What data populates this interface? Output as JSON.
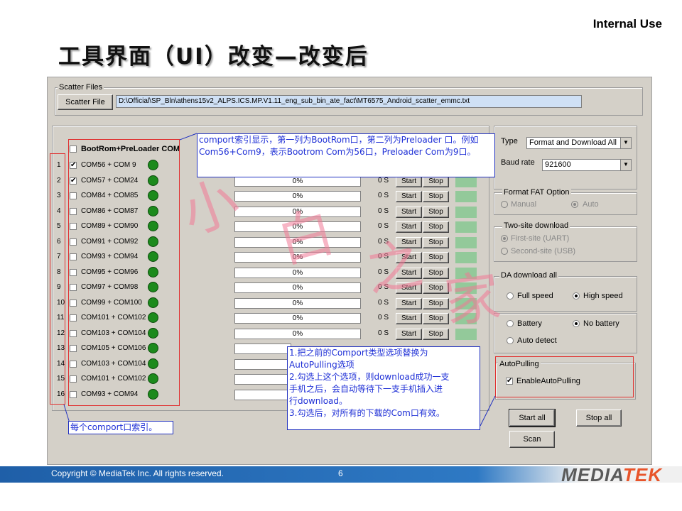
{
  "slide": {
    "internal_use": "Internal Use",
    "title": "工具界面（UI）改变—改变后",
    "copyright": "Copyright © MediaTek Inc. All rights reserved.",
    "page_number": "6",
    "brand_left": "MEDIA",
    "brand_right": "TEK",
    "watermark_chars": [
      "小",
      "白",
      "之",
      "家"
    ]
  },
  "scatter": {
    "group_title": "Scatter Files",
    "button_label": "Scatter File",
    "path": "D:\\Official\\SP_Bln\\athens15v2_ALPS.ICS.MP.V1.11_eng_sub_bin_ate_fact\\MT6575_Android_scatter_emmc.txt"
  },
  "ports": {
    "header_label": "BootRom+PreLoader COM",
    "header_checked": false,
    "start_label": "Start",
    "stop_label": "Stop",
    "rows": [
      {
        "num": "1",
        "label": "COM56 + COM 9",
        "checked": true,
        "progress": null,
        "time": null
      },
      {
        "num": "2",
        "label": "COM57 + COM24",
        "checked": true,
        "progress": "0%",
        "time": "0 S"
      },
      {
        "num": "3",
        "label": "COM84 + COM85",
        "checked": false,
        "progress": "0%",
        "time": "0 S"
      },
      {
        "num": "4",
        "label": "COM86 + COM87",
        "checked": false,
        "progress": "0%",
        "time": "0 S"
      },
      {
        "num": "5",
        "label": "COM89 + COM90",
        "checked": false,
        "progress": "0%",
        "time": "0 S"
      },
      {
        "num": "6",
        "label": "COM91 + COM92",
        "checked": false,
        "progress": "0%",
        "time": "0 S"
      },
      {
        "num": "7",
        "label": "COM93 + COM94",
        "checked": false,
        "progress": "0%",
        "time": "0 S"
      },
      {
        "num": "8",
        "label": "COM95 + COM96",
        "checked": false,
        "progress": "0%",
        "time": "0 S"
      },
      {
        "num": "9",
        "label": "COM97 + COM98",
        "checked": false,
        "progress": "0%",
        "time": "0 S"
      },
      {
        "num": "10",
        "label": "COM99 + COM100",
        "checked": false,
        "progress": "0%",
        "time": "0 S"
      },
      {
        "num": "11",
        "label": "COM101 + COM102",
        "checked": false,
        "progress": "0%",
        "time": "0 S"
      },
      {
        "num": "12",
        "label": "COM103 + COM104",
        "checked": false,
        "progress": "0%",
        "time": "0 S"
      },
      {
        "num": "13",
        "label": "COM105 + COM106",
        "checked": false,
        "progress": null,
        "time": null
      },
      {
        "num": "14",
        "label": "COM103 + COM104",
        "checked": false,
        "progress": null,
        "time": null
      },
      {
        "num": "15",
        "label": "COM101 + COM102",
        "checked": false,
        "progress": null,
        "time": null
      },
      {
        "num": "16",
        "label": "COM93 + COM94",
        "checked": false,
        "progress": null,
        "time": null
      }
    ]
  },
  "settings": {
    "type_label": "Type",
    "type_value": "Format and Download All",
    "baud_label": "Baud rate",
    "baud_value": "921600",
    "format_fat": {
      "title": "Format FAT Option",
      "manual": "Manual",
      "auto": "Auto"
    },
    "two_site": {
      "title": "Two-site download",
      "first": "First-site (UART)",
      "second": "Second-site (USB)"
    },
    "da_download": {
      "title": "DA download all",
      "full": "Full speed",
      "high": "High speed"
    },
    "battery": {
      "battery": "Battery",
      "no_battery": "No battery",
      "auto_detect": "Auto detect"
    },
    "autopulling": {
      "title": "AutoPulling",
      "checkbox": "EnableAutoPulling",
      "checked": true
    },
    "start_all": "Start all",
    "stop_all": "Stop all",
    "scan": "Scan"
  },
  "annotations": {
    "comport_note": "comport索引显示，第一列为BootRom口，第二列为Preloader 口。例如Com56+Com9，表示Bootrom Com为56口，Preloader Com为9口。",
    "index_note": "每个comport口索引。",
    "autopulling_note_lines": [
      "1.把之前的Comport类型选项替换为",
      "AutoPulling选项",
      "2.勾选上这个选项，则download成功一支",
      "手机之后，会自动等待下一支手机插入进",
      "行download。",
      "3.勾选后，对所有的下载的Com口有效。"
    ]
  },
  "colors": {
    "window_bg": "#d4d0c8",
    "led_green": "#1c8a1c",
    "highlight_red": "#e03030",
    "note_blue": "#1e2fd6",
    "footer_blue": "#1f5fa8",
    "brand_orange": "#e8542a"
  }
}
